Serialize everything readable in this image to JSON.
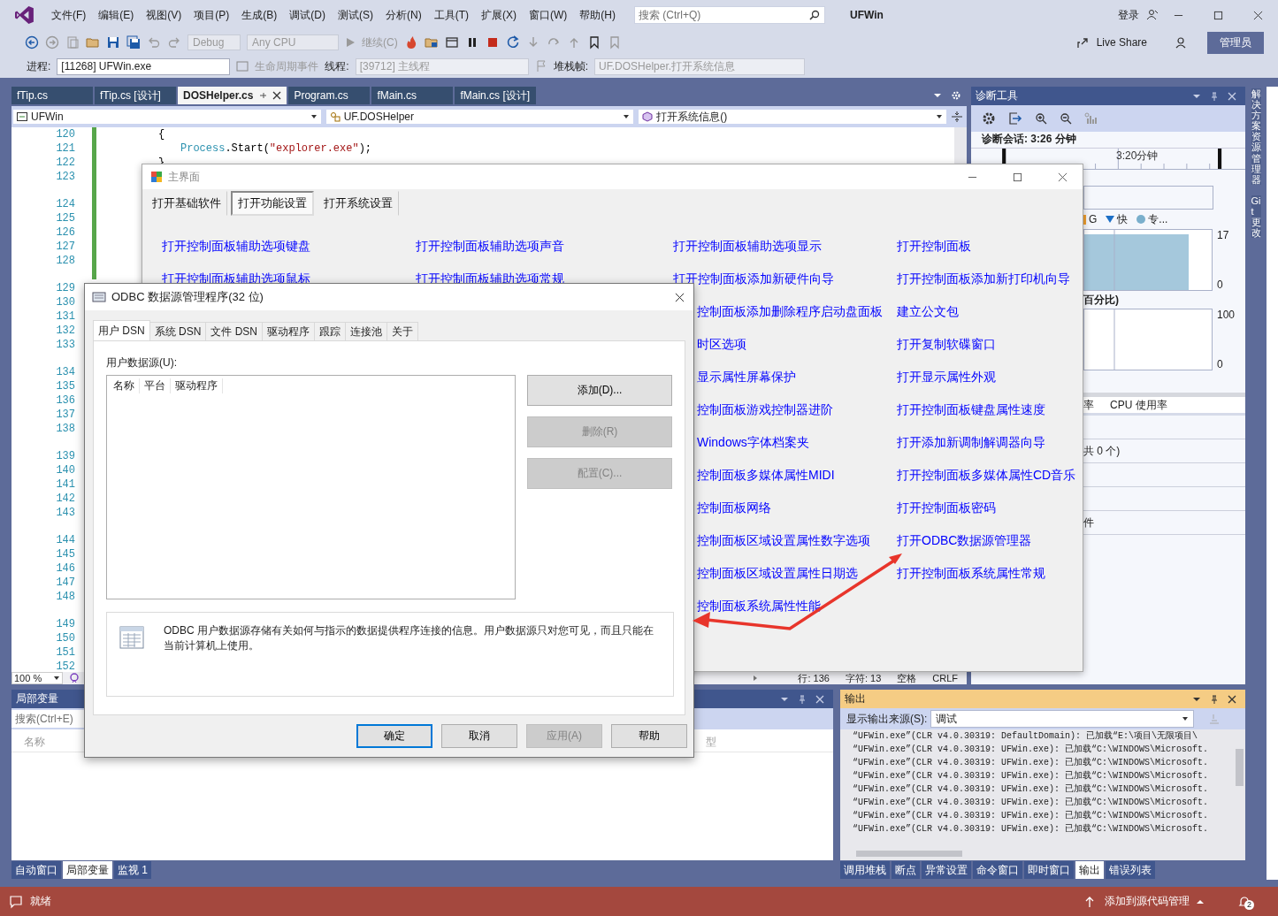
{
  "menu_bar": {
    "items": [
      "文件(F)",
      "编辑(E)",
      "视图(V)",
      "项目(P)",
      "生成(B)",
      "调试(D)",
      "测试(S)",
      "分析(N)",
      "工具(T)",
      "扩展(X)",
      "窗口(W)",
      "帮助(H)"
    ],
    "search": {
      "placeholder": "搜索 (Ctrl+Q)"
    },
    "title": "UFWin",
    "sign_in": "登录"
  },
  "toolbar": {
    "configuration": {
      "text": "Debug",
      "disabled": true
    },
    "platform": {
      "text": "Any CPU",
      "disabled": true
    },
    "continue": "继续(C)",
    "live_share": "Live Share",
    "admin": "管理员"
  },
  "debug_bar": {
    "process_label": "进程:",
    "process": "[11268] UFWin.exe",
    "lifecycle": "生命周期事件",
    "thread_label": "线程:",
    "thread": "[39712] 主线程",
    "stack_label": "堆栈帧:",
    "stack_frame": "UF.DOSHelper.打开系统信息"
  },
  "editor": {
    "tabs": [
      {
        "label": "fTip.cs",
        "selected": false
      },
      {
        "label": "fTip.cs [设计]",
        "selected": false
      },
      {
        "label": "DOSHelper.cs",
        "selected": true
      },
      {
        "label": "Program.cs",
        "selected": false
      },
      {
        "label": "fMain.cs",
        "selected": false
      },
      {
        "label": "fMain.cs [设计]",
        "selected": false
      }
    ],
    "nav": [
      "UFWin",
      "UF.DOSHelper",
      "打开系统信息()"
    ],
    "line_numbers": [
      "120",
      "121",
      "122",
      "123",
      "124",
      "125",
      "126",
      "127",
      "128",
      "129",
      "130",
      "131",
      "132",
      "133",
      "134",
      "135",
      "136",
      "137",
      "138",
      "139",
      "140",
      "141",
      "142",
      "143",
      "144",
      "145",
      "146",
      "147",
      "148",
      "149",
      "150",
      "151",
      "152"
    ],
    "code_lines": [
      [
        {
          "kind": "plain",
          "text": "{"
        }
      ],
      [
        {
          "kind": "type",
          "text": "Process"
        },
        {
          "kind": "plain",
          "text": ".Start("
        },
        {
          "kind": "string",
          "text": "\"explorer.exe\""
        },
        {
          "kind": "plain",
          "text": ");"
        }
      ],
      [
        {
          "kind": "plain",
          "text": "}"
        }
      ]
    ],
    "zoom": "100 %",
    "status": [
      "行: 136",
      "字符: 13",
      "空格",
      "CRLF"
    ]
  },
  "main_form": {
    "title": "主界面",
    "tabs": [
      {
        "label": "打开基础软件",
        "selected": false
      },
      {
        "label": "打开功能设置",
        "selected": true
      },
      {
        "label": "打开系统设置",
        "selected": false
      }
    ],
    "link_columns": [
      {
        "links": [
          "打开控制面板辅助选项键盘",
          "打开控制面板辅助选项鼠标"
        ]
      },
      {
        "links": [
          "打开控制面板辅助选项声音",
          "打开控制面板辅助选项常规"
        ]
      },
      {
        "links": [
          "打开控制面板辅助选项显示",
          "打开控制面板添加新硬件向导"
        ],
        "partly_hidden_links": [
          "控制面板添加删除程序启动盘面板",
          "时区选项",
          "显示属性屏幕保护",
          "控制面板游戏控制器进阶",
          "Windows字体档案夹",
          "控制面板多媒体属性MIDI",
          "控制面板网络",
          "控制面板区域设置属性数字选项",
          "控制面板区域设置属性日期选",
          "控制面板系统属性性能"
        ]
      },
      {
        "links": [
          "打开控制面板",
          "打开控制面板添加新打印机向导",
          "建立公文包",
          "打开复制软碟窗口",
          "打开显示属性外观",
          "打开控制面板键盘属性速度",
          "打开添加新调制解调器向导",
          "打开控制面板多媒体属性CD音乐",
          "打开控制面板密码",
          "打开ODBC数据源管理器",
          "打开控制面板系统属性常规"
        ]
      }
    ]
  },
  "odbc_dialog": {
    "title": "ODBC 数据源管理程序(32 位)",
    "tabs": [
      {
        "label": "用户 DSN",
        "selected": true
      },
      {
        "label": "系统 DSN",
        "selected": false
      },
      {
        "label": "文件 DSN",
        "selected": false
      },
      {
        "label": "驱动程序",
        "selected": false
      },
      {
        "label": "跟踪",
        "selected": false
      },
      {
        "label": "连接池",
        "selected": false
      },
      {
        "label": "关于",
        "selected": false
      }
    ],
    "list_label": "用户数据源(U):",
    "columns": [
      "名称",
      "平台",
      "驱动程序"
    ],
    "side_buttons": [
      {
        "label": "添加(D)...",
        "disabled": false
      },
      {
        "label": "删除(R)",
        "disabled": true
      },
      {
        "label": "配置(C)...",
        "disabled": true
      }
    ],
    "info": "ODBC 用户数据源存储有关如何与指示的数据提供程序连接的信息。用户数据源只对您可见，而且只能在当前计算机上使用。",
    "buttons": [
      {
        "label": "确定",
        "disabled": false,
        "default": true
      },
      {
        "label": "取消",
        "disabled": false,
        "default": false
      },
      {
        "label": "应用(A)",
        "disabled": true,
        "default": false
      },
      {
        "label": "帮助",
        "disabled": false,
        "default": false
      }
    ]
  },
  "diagnostics": {
    "title": "诊断工具",
    "session": "诊断会话: 3:26 分钟",
    "timeline_label": "3:20分钟",
    "legend": [
      {
        "kind": "bar",
        "label": "G"
      },
      {
        "kind": "triangle",
        "label": "快"
      },
      {
        "kind": "dot",
        "label": "专..."
      }
    ],
    "memory_axis": [
      "17",
      "0"
    ],
    "cpu_title": "百分比)",
    "cpu_axis": [
      "100",
      "0"
    ],
    "tab_texts": [
      "率",
      "CPU 使用率"
    ],
    "rows": [
      "共 0 个)",
      "件"
    ]
  },
  "side_tabs": [
    "解决方案资源管理器",
    "Git 更改"
  ],
  "locals": {
    "title": "局部变量",
    "search": {
      "placeholder": "搜索(Ctrl+E)"
    },
    "columns": [
      "名称",
      "型"
    ],
    "tabs": [
      {
        "label": "自动窗口",
        "selected": false
      },
      {
        "label": "局部变量",
        "selected": true
      },
      {
        "label": "监视 1",
        "selected": false
      }
    ]
  },
  "output": {
    "title": "输出",
    "source_label": "显示输出来源(S):",
    "source": "调试",
    "lines": [
      "“UFWin.exe”(CLR v4.0.30319: DefaultDomain): 已加载“E:\\项目\\无限项目\\",
      "“UFWin.exe”(CLR v4.0.30319: UFWin.exe): 已加载“C:\\WINDOWS\\Microsoft.",
      "“UFWin.exe”(CLR v4.0.30319: UFWin.exe): 已加载“C:\\WINDOWS\\Microsoft.",
      "“UFWin.exe”(CLR v4.0.30319: UFWin.exe): 已加载“C:\\WINDOWS\\Microsoft.",
      "“UFWin.exe”(CLR v4.0.30319: UFWin.exe): 已加载“C:\\WINDOWS\\Microsoft.",
      "“UFWin.exe”(CLR v4.0.30319: UFWin.exe): 已加载“C:\\WINDOWS\\Microsoft.",
      "“UFWin.exe”(CLR v4.0.30319: UFWin.exe): 已加载“C:\\WINDOWS\\Microsoft.",
      "“UFWin.exe”(CLR v4.0.30319: UFWin.exe): 已加载“C:\\WINDOWS\\Microsoft."
    ],
    "tabs": [
      {
        "label": "调用堆栈",
        "selected": false
      },
      {
        "label": "断点",
        "selected": false
      },
      {
        "label": "异常设置",
        "selected": false
      },
      {
        "label": "命令窗口",
        "selected": false
      },
      {
        "label": "即时窗口",
        "selected": false
      },
      {
        "label": "输出",
        "selected": true
      },
      {
        "label": "错误列表",
        "selected": false
      }
    ]
  },
  "status_bar": {
    "text": "就绪",
    "source_control": "添加到源代码管理",
    "notifications": "2"
  }
}
